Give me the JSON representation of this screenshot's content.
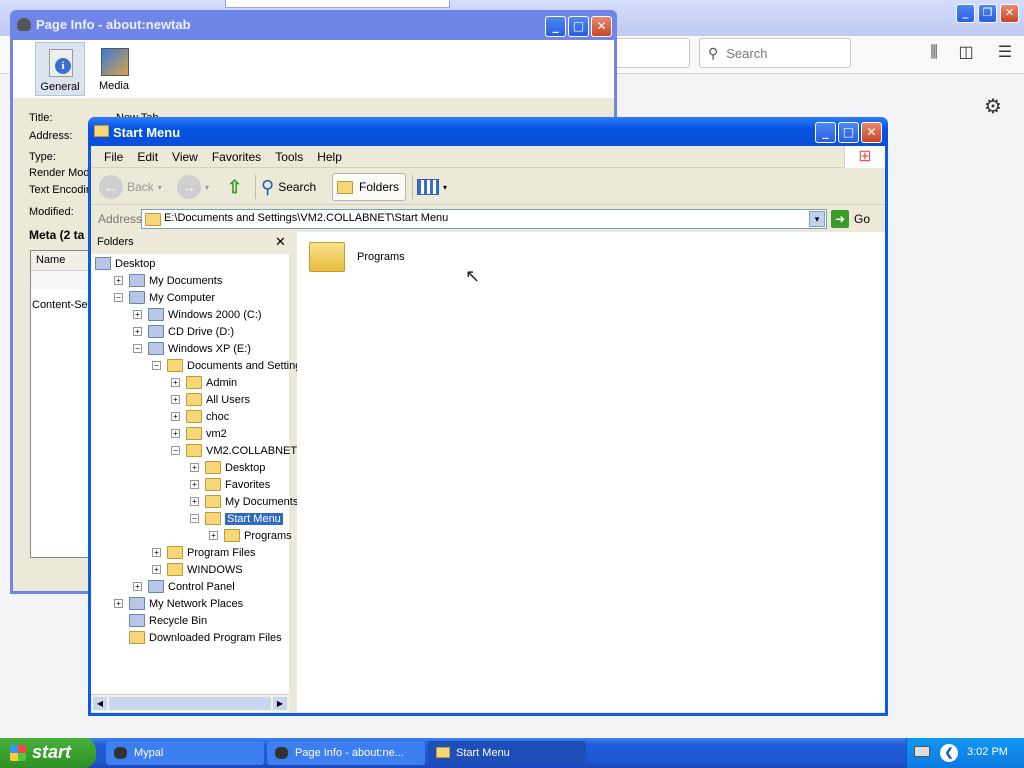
{
  "firefox": {
    "search_placeholder": "Search",
    "icons": [
      "library-icon",
      "sidebar-icon",
      "menu-icon",
      "gear-icon"
    ]
  },
  "page_info": {
    "title": "Page Info - about:newtab",
    "tabs": [
      {
        "label": "General"
      },
      {
        "label": "Media"
      }
    ],
    "fields": [
      {
        "label": "Title:",
        "value": "New Tab"
      },
      {
        "label": "Address:",
        "value": ""
      },
      {
        "label": "Type:",
        "value": ""
      },
      {
        "label": "Render Mod",
        "value": ""
      },
      {
        "label": "Text Encodin",
        "value": ""
      },
      {
        "label": "Modified:",
        "value": ""
      }
    ],
    "meta_heading": "Meta (2 ta",
    "meta_col": "Name",
    "meta_row": "Content-Se"
  },
  "explorer": {
    "title": "Start Menu",
    "menu": [
      "File",
      "Edit",
      "View",
      "Favorites",
      "Tools",
      "Help"
    ],
    "toolbar": {
      "back": "Back",
      "search": "Search",
      "folders": "Folders"
    },
    "address_label": "Address",
    "address_value": "E:\\Documents and Settings\\VM2.COLLABNET\\Start Menu",
    "go_label": "Go",
    "folders_title": "Folders",
    "tree": [
      {
        "label": "Desktop",
        "indent": 0,
        "pm": "",
        "sys": true
      },
      {
        "label": "My Documents",
        "indent": 1,
        "pm": "+",
        "sys": true
      },
      {
        "label": "My Computer",
        "indent": 1,
        "pm": "−",
        "sys": true
      },
      {
        "label": "Windows 2000 (C:)",
        "indent": 2,
        "pm": "+",
        "sys": true
      },
      {
        "label": "CD Drive (D:)",
        "indent": 2,
        "pm": "+",
        "sys": true
      },
      {
        "label": "Windows XP (E:)",
        "indent": 2,
        "pm": "−",
        "sys": true
      },
      {
        "label": "Documents and Settings",
        "indent": 3,
        "pm": "−",
        "sys": false
      },
      {
        "label": "Admin",
        "indent": 4,
        "pm": "+",
        "sys": false
      },
      {
        "label": "All Users",
        "indent": 4,
        "pm": "+",
        "sys": false
      },
      {
        "label": "choc",
        "indent": 4,
        "pm": "+",
        "sys": false
      },
      {
        "label": "vm2",
        "indent": 4,
        "pm": "+",
        "sys": false
      },
      {
        "label": "VM2.COLLABNET",
        "indent": 4,
        "pm": "−",
        "sys": false
      },
      {
        "label": "Desktop",
        "indent": 5,
        "pm": "+",
        "sys": false
      },
      {
        "label": "Favorites",
        "indent": 5,
        "pm": "+",
        "sys": false
      },
      {
        "label": "My Documents",
        "indent": 5,
        "pm": "+",
        "sys": false
      },
      {
        "label": "Start Menu",
        "indent": 5,
        "pm": "−",
        "sys": false,
        "selected": true
      },
      {
        "label": "Programs",
        "indent": 6,
        "pm": "+",
        "sys": false
      },
      {
        "label": "Program Files",
        "indent": 3,
        "pm": "+",
        "sys": false
      },
      {
        "label": "WINDOWS",
        "indent": 3,
        "pm": "+",
        "sys": false
      },
      {
        "label": "Control Panel",
        "indent": 2,
        "pm": "+",
        "sys": true
      },
      {
        "label": "My Network Places",
        "indent": 1,
        "pm": "+",
        "sys": true
      },
      {
        "label": "Recycle Bin",
        "indent": 1,
        "pm": "",
        "sys": true
      },
      {
        "label": "Downloaded Program Files",
        "indent": 1,
        "pm": "",
        "sys": false
      }
    ],
    "items": [
      {
        "label": "Programs"
      }
    ]
  },
  "taskbar": {
    "start": "start",
    "tasks": [
      {
        "label": "Mypal"
      },
      {
        "label": "Page Info - about:ne..."
      },
      {
        "label": "Start Menu"
      }
    ],
    "clock": "3:02 PM"
  }
}
